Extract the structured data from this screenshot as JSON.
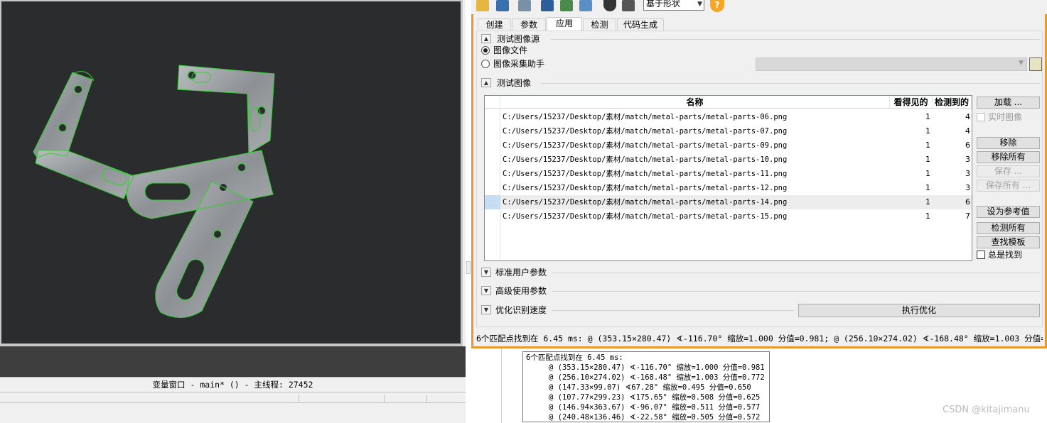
{
  "graphics_window": {
    "variable_window_title": "变量窗口 - main* () - 主线程: 27452"
  },
  "toolbar": {
    "icons": [
      "open-icon",
      "save-icon",
      "load-model-icon",
      "save-model-icon",
      "image-icon",
      "image-icon-2",
      "timer-icon",
      "inspect-icon"
    ],
    "method_select": "基于形状",
    "help_label": "?"
  },
  "tabs": [
    {
      "label": "创建"
    },
    {
      "label": "参数"
    },
    {
      "label": "应用"
    },
    {
      "label": "检测"
    },
    {
      "label": "代码生成"
    }
  ],
  "test_source": {
    "section_title": "测试图像源",
    "option_file": "图像文件",
    "option_acq": "图像采集助手"
  },
  "test_images": {
    "section_title": "测试图像",
    "columns": {
      "name": "名称",
      "seen": "看得见的",
      "detected": "检测到的"
    },
    "rows": [
      {
        "name": "C:/Users/15237/Desktop/素材/match/metal-parts/metal-parts-06.png",
        "seen": "1",
        "detected": "4"
      },
      {
        "name": "C:/Users/15237/Desktop/素材/match/metal-parts/metal-parts-07.png",
        "seen": "1",
        "detected": "4"
      },
      {
        "name": "C:/Users/15237/Desktop/素材/match/metal-parts/metal-parts-09.png",
        "seen": "1",
        "detected": "6"
      },
      {
        "name": "C:/Users/15237/Desktop/素材/match/metal-parts/metal-parts-10.png",
        "seen": "1",
        "detected": "3"
      },
      {
        "name": "C:/Users/15237/Desktop/素材/match/metal-parts/metal-parts-11.png",
        "seen": "1",
        "detected": "3"
      },
      {
        "name": "C:/Users/15237/Desktop/素材/match/metal-parts/metal-parts-12.png",
        "seen": "1",
        "detected": "3"
      },
      {
        "name": "C:/Users/15237/Desktop/素材/match/metal-parts/metal-parts-14.png",
        "seen": "1",
        "detected": "6"
      },
      {
        "name": "C:/Users/15237/Desktop/素材/match/metal-parts/metal-parts-15.png",
        "seen": "1",
        "detected": "7"
      }
    ],
    "selected_row": 6
  },
  "side_buttons": {
    "load": "加载 ...",
    "live_image": "实时图像",
    "remove": "移除",
    "remove_all": "移除所有",
    "save": "保存 ...",
    "save_all": "保存所有 ...",
    "set_reference": "设为参考值",
    "detect_all": "检测所有",
    "find_model": "查找模板",
    "always_find": "总是找到"
  },
  "collapsed_sections": {
    "standard_params": "标准用户参数",
    "advanced_params": "高级使用参数",
    "optimize_speed": "优化识别速度",
    "run_optimize": "执行优化"
  },
  "status_line": "6个匹配点找到在 6.45 ms: @ (353.15×280.47) ∢-116.70°  缩放=1.000 分值=0.981; @ (256.10×274.02) ∢-168.48°  缩放=1.003 分值=0.7…",
  "tooltip": {
    "header": "6个匹配点找到在 6.45 ms:",
    "lines": [
      "@ (353.15×280.47) ∢-116.70°  缩放=1.000 分值=0.981",
      "@ (256.10×274.02) ∢-168.48°  缩放=1.003 分值=0.772",
      "@ (147.33×99.07) ∢67.28°  缩放=0.495 分值=0.650",
      "@ (107.77×299.23) ∢175.65°  缩放=0.508 分值=0.625",
      "@ (146.94×363.67) ∢-96.07°  缩放=0.511 分值=0.577",
      "@ (240.48×136.46) ∢-22.58°  缩放=0.505 分值=0.572"
    ]
  },
  "watermark": "CSDN @kitajimanu",
  "colors": {
    "panel_border": "#e89a2f",
    "match_contour": "#2ed22e",
    "image_background": "#2b2c2d",
    "selection": "#c5dcf3"
  }
}
